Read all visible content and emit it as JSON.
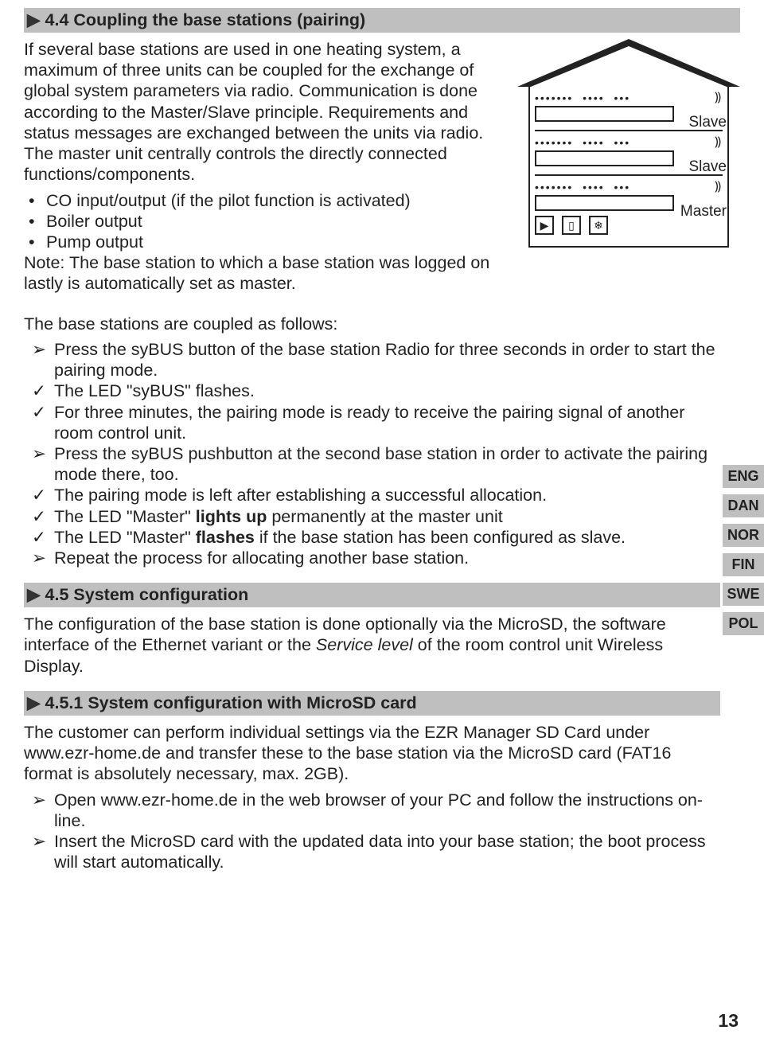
{
  "s44": {
    "title": "4.4 Coupling the base stations (pairing)",
    "intro": "If several base stations are used in one heating system, a maximum of three units can be coupled for the exchange of global system parameters via radio. Communication is done according to the Master/Slave principle. Requirements and status messages are exchanged between the units via radio. The master unit centrally controls the directly connected functions/components.",
    "bullets": [
      "CO input/output (if the pilot function is activated)",
      "Boiler output",
      "Pump output"
    ],
    "note": "Note: The base station to which a base station was logged on lastly is automatically set as master.",
    "diagram": {
      "slave1": "Slave",
      "slave2": "Slave",
      "master": "Master"
    },
    "coupled_intro": "The base stations are coupled as follows:",
    "steps": [
      {
        "t": "arrow",
        "text": "Press the syBUS button of the base station Radio for three seconds in order to start the pairing mode."
      },
      {
        "t": "check",
        "text": "The LED \"syBUS\" flashes."
      },
      {
        "t": "check",
        "text": "For three minutes, the pairing mode is ready to receive the pairing signal of another room control unit."
      },
      {
        "t": "arrow",
        "text": "Press the syBUS pushbutton at the second base station in order to activate the pairing mode there, too."
      },
      {
        "t": "check",
        "text": "The pairing mode is left after establishing a successful allocation."
      },
      {
        "t": "check",
        "html": "The LED \"Master\" <b>lights up</b> permanently at the master unit"
      },
      {
        "t": "check",
        "html": "The LED \"Master\" <b>flashes</b> if the base station has been configured as slave."
      },
      {
        "t": "arrow",
        "text": "Repeat the process for allocating another base station."
      }
    ]
  },
  "s45": {
    "title": "4.5 System configuration",
    "body_pre": "The configuration of the base station is done optionally via the MicroSD, the software interface of the Ethernet variant or the ",
    "body_italic": "Service level",
    "body_post": " of the room control unit Wireless Display."
  },
  "s451": {
    "title": "4.5.1 System configuration with MicroSD card",
    "body": "The customer can perform individual settings via the EZR Manager SD Card under www.ezr-home.de and transfer these to the base station via the MicroSD card (FAT16 format is absolutely necessary, max. 2GB).",
    "steps": [
      {
        "t": "arrow",
        "text": "Open www.ezr-home.de in the web browser of your PC and follow the instructions on-line."
      },
      {
        "t": "arrow",
        "text": "Insert the MicroSD card with the updated data into your base station; the boot process will start automatically."
      }
    ]
  },
  "langs": [
    "ENG",
    "DAN",
    "NOR",
    "FIN",
    "SWE",
    "POL"
  ],
  "pageNum": "13"
}
